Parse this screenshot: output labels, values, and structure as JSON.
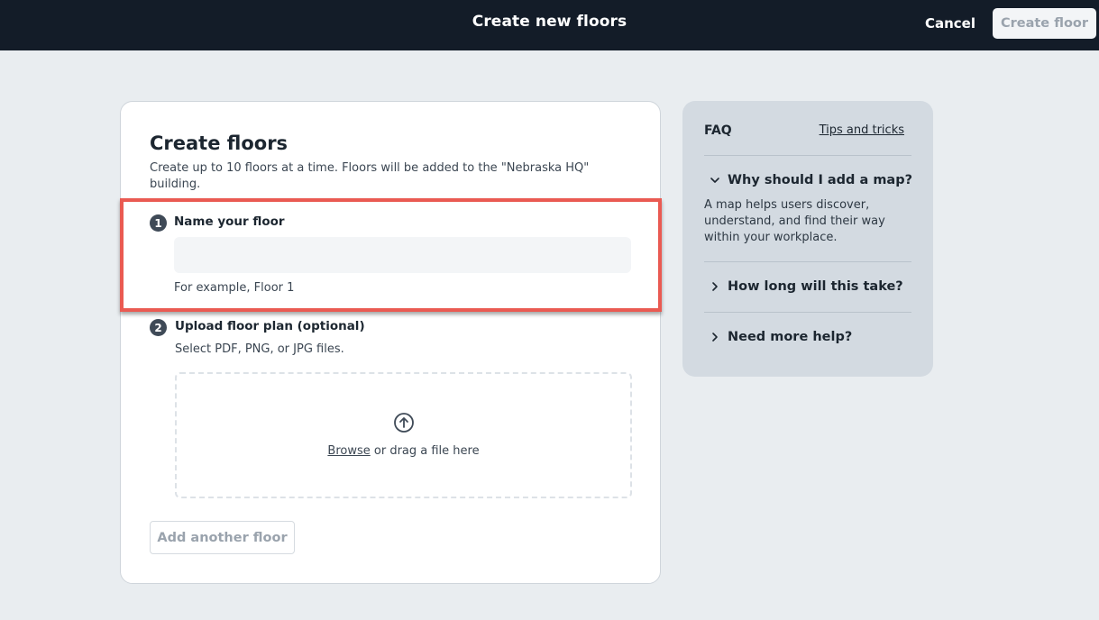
{
  "header": {
    "title": "Create new floors",
    "cancel_label": "Cancel",
    "create_floor_label": "Create floor"
  },
  "card": {
    "title": "Create floors",
    "subtitle": "Create up to 10 floors at a time. Floors will be added to the \"Nebraska HQ\" building.",
    "step1": {
      "number": "1",
      "label": "Name your floor",
      "input_value": "",
      "hint": "For example, Floor 1"
    },
    "step2": {
      "number": "2",
      "label": "Upload floor plan (optional)",
      "hint": "Select PDF, PNG, or JPG files.",
      "browse_label": "Browse",
      "drag_text": " or drag a file here"
    },
    "add_floor_label": "Add another floor"
  },
  "faq": {
    "title": "FAQ",
    "tips_label": "Tips and tricks",
    "items": [
      {
        "label": "Why should I add a map?",
        "expanded": true,
        "answer": "A map helps users discover, understand, and find their way within your workplace."
      },
      {
        "label": "How long will this take?",
        "expanded": false
      },
      {
        "label": "Need more help?",
        "expanded": false
      }
    ]
  },
  "colors": {
    "topbar": "#131c28",
    "background": "#e9edf0",
    "highlight": "#ea5a52",
    "faq_panel": "#d3dae1",
    "badge": "#3f4a57"
  },
  "icons": {
    "upload": "upload-arrow-circle-icon",
    "expanded": "chevron-down-icon",
    "collapsed": "chevron-right-icon"
  }
}
